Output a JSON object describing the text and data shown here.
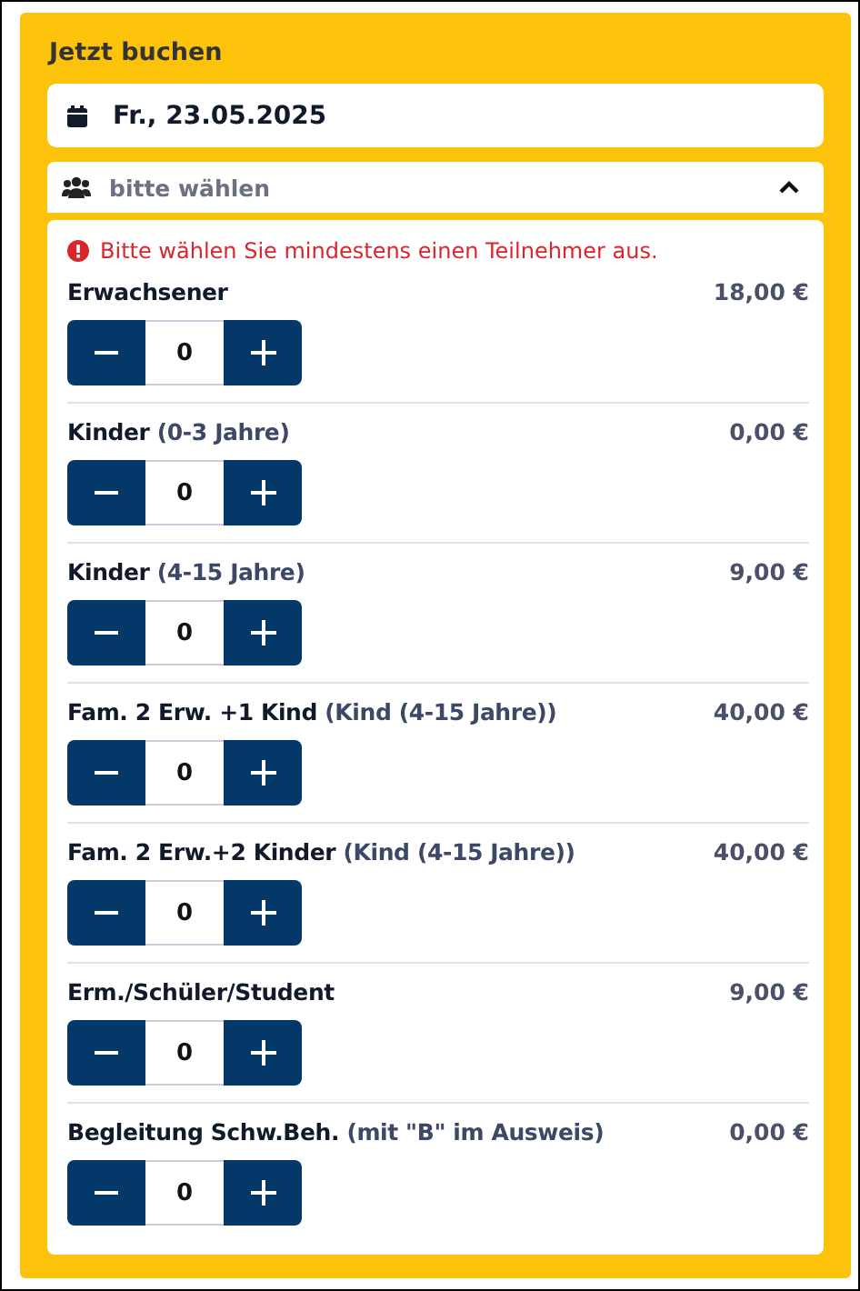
{
  "heading": "Jetzt buchen",
  "date": {
    "value": "Fr., 23.05.2025"
  },
  "participants": {
    "placeholder": "bitte wählen",
    "expanded": true
  },
  "error": "Bitte wählen Sie mindestens einen Teilnehmer aus.",
  "tickets": [
    {
      "name": "Erwachsener",
      "price": "18,00 €",
      "count": "0"
    },
    {
      "name": "Kinder",
      "note": "(0-3 Jahre)",
      "price": "0,00 €",
      "count": "0"
    },
    {
      "name": "Kinder",
      "note": "(4-15 Jahre)",
      "price": "9,00 €",
      "count": "0"
    },
    {
      "name": "Fam. 2 Erw. +1 Kind",
      "note": "(Kind (4-15 Jahre))",
      "price": "40,00 €",
      "count": "0"
    },
    {
      "name": "Fam. 2 Erw.+2 Kinder",
      "note": "(Kind (4-15 Jahre))",
      "price": "40,00 €",
      "count": "0"
    },
    {
      "name": "Erm./Schüler/Student",
      "price": "9,00 €",
      "count": "0"
    },
    {
      "name": "Begleitung Schw.Beh.",
      "note": "(mit \"B\" im Ausweis)",
      "price": "0,00 €",
      "count": "0"
    }
  ]
}
